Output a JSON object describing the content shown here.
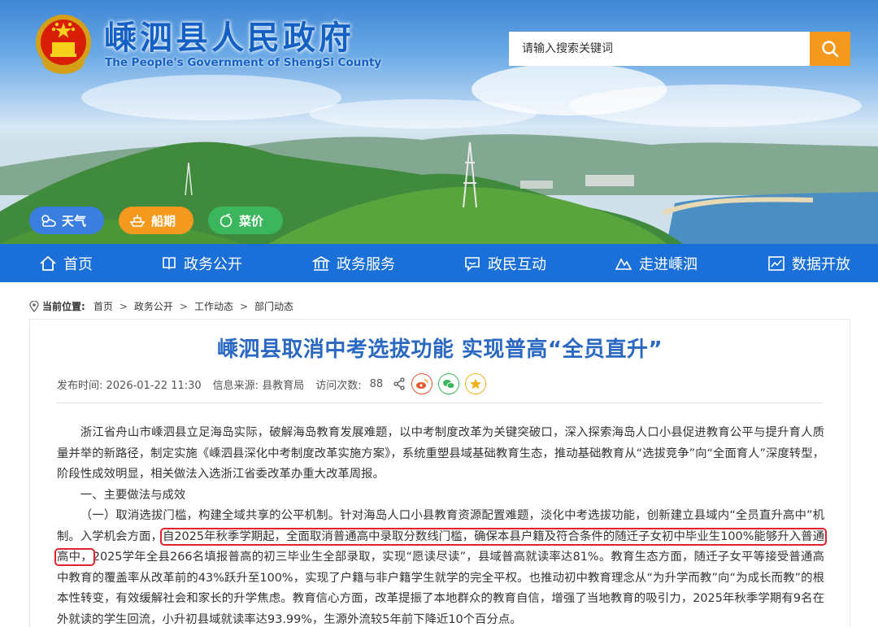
{
  "header": {
    "title": "嵊泗县人民政府",
    "subtitle": "The People's Government of ShengSi County",
    "search_placeholder": "请输入搜索关键词"
  },
  "quick_links": [
    {
      "label": "天气",
      "icon": "weather-icon",
      "color": "#3a7fe0"
    },
    {
      "label": "船期",
      "icon": "ship-icon",
      "color": "#f39a1e"
    },
    {
      "label": "菜价",
      "icon": "vegetable-icon",
      "color": "#3cb65c"
    }
  ],
  "nav": [
    {
      "label": "首页",
      "icon": "home-icon"
    },
    {
      "label": "政务公开",
      "icon": "book-icon"
    },
    {
      "label": "政务服务",
      "icon": "bank-icon"
    },
    {
      "label": "政民互动",
      "icon": "chat-icon"
    },
    {
      "label": "走进嵊泗",
      "icon": "mountain-icon"
    },
    {
      "label": "数据开放",
      "icon": "chart-icon"
    }
  ],
  "breadcrumb": {
    "label": "当前位置:",
    "items": [
      "首页",
      "政务公开",
      "工作动态",
      "部门动态"
    ],
    "separator": ">"
  },
  "article": {
    "title": "嵊泗县取消中考选拔功能 实现普高“全员直升”",
    "meta": {
      "publish": "发布时间: 2026-01-22 11:30",
      "source": "信息来源: 县教育局",
      "visits_label": "访问次数:",
      "visits": "88"
    },
    "paragraphs": {
      "p1": "浙江省舟山市嵊泗县立足海岛实际，破解海岛教育发展难题，以中考制度改革为关键突破口，深入探索海岛人口小县促进教育公平与提升育人质量并举的新路径，制定实施《嵊泗县深化中考制度改革实施方案》，系统重塑县域基础教育生态，推动基础教育从“选拔竞争”向“全面育人”深度转型，阶段性成效明显，相关做法入选浙江省委改革办重大改革周报。",
      "p2": "一、主要做法与成效",
      "p3_before": "（一）取消选拔门槛，构建全域共享的公平机制。针对海岛人口小县教育资源配置难题，淡化中考选拔功能，创新建立县域内“全员直升高中”机制。入学机会方面，",
      "p3_highlight": "自2025年秋季学期起，全面取消普通高中录取分数线门槛，确保本县户籍及符合条件的随迁子女初中毕业生100%能够升入普通高中，",
      "p3_after": "2025学年全县266名填报普高的初三毕业生全部录取，实现“愿读尽读”，县域普高就读率达81%。教育生态方面，随迁子女平等接受普通高中教育的覆盖率从改革前的43%跃升至100%，实现了户籍与非户籍学生就学的完全平权。也推动初中教育理念从“为升学而教”向“为成长而教”的根本性转变，有效缓解社会和家长的升学焦虑。教育信心方面，改革提振了本地群众的教育自信，增强了当地教育的吸引力，2025年秋季学期有9名在外就读的学生回流，小升初县域就读率达93.99%，生源外流较5年前下降近10个百分点。"
    }
  },
  "colors": {
    "nav_blue": "#1a6fd8",
    "title_blue": "#2a68c2",
    "accent_orange": "#f39a1e",
    "highlight_red": "#e0242f"
  }
}
